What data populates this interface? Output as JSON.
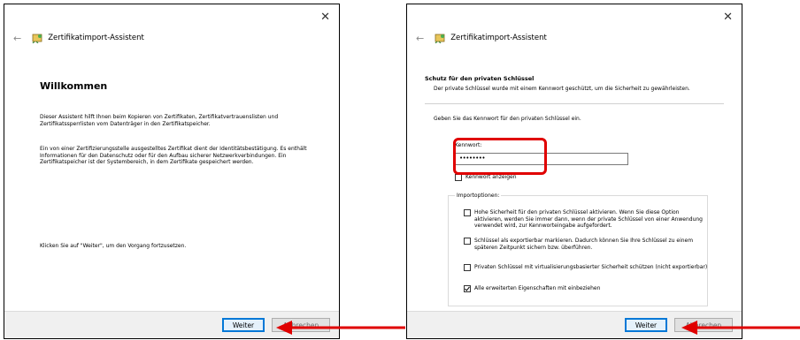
{
  "common": {
    "title": "Zertifikatimport-Assistent",
    "close_glyph": "✕",
    "back_glyph": "←",
    "next_label": "Weiter",
    "cancel_label": "Abbrechen"
  },
  "wizard1": {
    "heading": "Willkommen",
    "para1": "Dieser Assistent hilft Ihnen beim Kopieren von Zertifikaten, Zertifikatvertrauenslisten und Zertifikatssperrlisten vom Datenträger in den Zertifikatspeicher.",
    "para2": "Ein von einer Zertifizierungsstelle ausgestelltes Zertifikat dient der Identitätsbestätigung. Es enthält Informationen für den Datenschutz oder für den Aufbau sicherer Netzwerkverbindungen. Ein Zertifikatspeicher ist der Systembereich, in dem Zertifikate gespeichert werden.",
    "para3": "Klicken Sie auf \"Weiter\", um den Vorgang fortzusetzen."
  },
  "wizard2": {
    "section_title": "Schutz für den privaten Schlüssel",
    "section_desc": "Der private Schlüssel wurde mit einem Kennwort geschützt, um die Sicherheit zu gewährleisten.",
    "instruction": "Geben Sie das Kennwort für den privaten Schlüssel ein.",
    "password_label": "Kennwort:",
    "password_value": "••••••••",
    "show_password_label": "Kennwort anzeigen",
    "import_options_label": "Importoptionen:",
    "options": [
      {
        "label": "Hohe Sicherheit für den privaten Schlüssel aktivieren. Wenn Sie diese Option aktivieren, werden Sie immer dann, wenn der private Schlüssel von einer Anwendung verwendet wird, zur Kennworteingabe aufgefordert.",
        "checked": false
      },
      {
        "label": "Schlüssel als exportierbar markieren. Dadurch können Sie Ihre Schlüssel zu einem späteren Zeitpunkt sichern bzw. überführen.",
        "checked": false
      },
      {
        "label": "Privaten Schlüssel mit virtualisierungsbasierter Sicherheit schützen (nicht exportierbar)",
        "checked": false
      },
      {
        "label": "Alle erweiterten Eigenschaften mit einbeziehen",
        "checked": true
      }
    ]
  },
  "colors": {
    "annotation_red": "#e00000",
    "button_accent": "#0078d7"
  }
}
